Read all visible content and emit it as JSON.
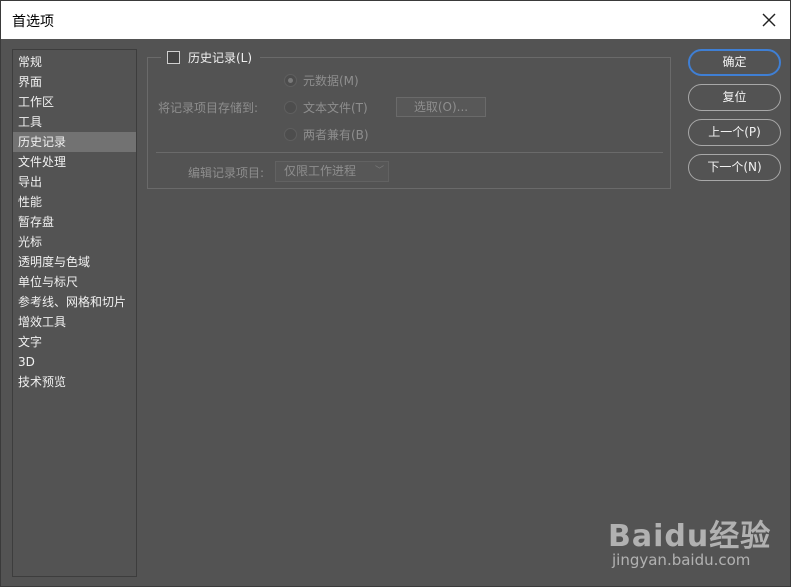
{
  "window": {
    "title": "首选项",
    "close_icon": "close-icon"
  },
  "sidebar": {
    "items": [
      {
        "label": "常规"
      },
      {
        "label": "界面"
      },
      {
        "label": "工作区"
      },
      {
        "label": "工具"
      },
      {
        "label": "历史记录",
        "selected": true
      },
      {
        "label": "文件处理"
      },
      {
        "label": "导出"
      },
      {
        "label": "性能"
      },
      {
        "label": "暂存盘"
      },
      {
        "label": "光标"
      },
      {
        "label": "透明度与色域"
      },
      {
        "label": "单位与标尺"
      },
      {
        "label": "参考线、网格和切片"
      },
      {
        "label": "增效工具"
      },
      {
        "label": "文字"
      },
      {
        "label": "3D"
      },
      {
        "label": "技术预览"
      }
    ]
  },
  "history": {
    "checkbox_label": "历史记录(L)",
    "checked": false,
    "save_to_label": "将记录项目存储到:",
    "options": [
      {
        "label": "元数据(M)",
        "selected": true
      },
      {
        "label": "文本文件(T)",
        "selected": false
      },
      {
        "label": "两者兼有(B)",
        "selected": false
      }
    ],
    "choose_button": "选取(O)...",
    "edit_log_label": "编辑记录项目:",
    "edit_log_value": "仅限工作进程"
  },
  "buttons": {
    "ok": "确定",
    "reset": "复位",
    "prev": "上一个(P)",
    "next": "下一个(N)"
  },
  "watermark": {
    "logo": "Baidu经验",
    "url": "jingyan.baidu.com"
  },
  "colors": {
    "background": "#535353",
    "selected_item": "#727272",
    "accent": "#3f7fd4"
  }
}
